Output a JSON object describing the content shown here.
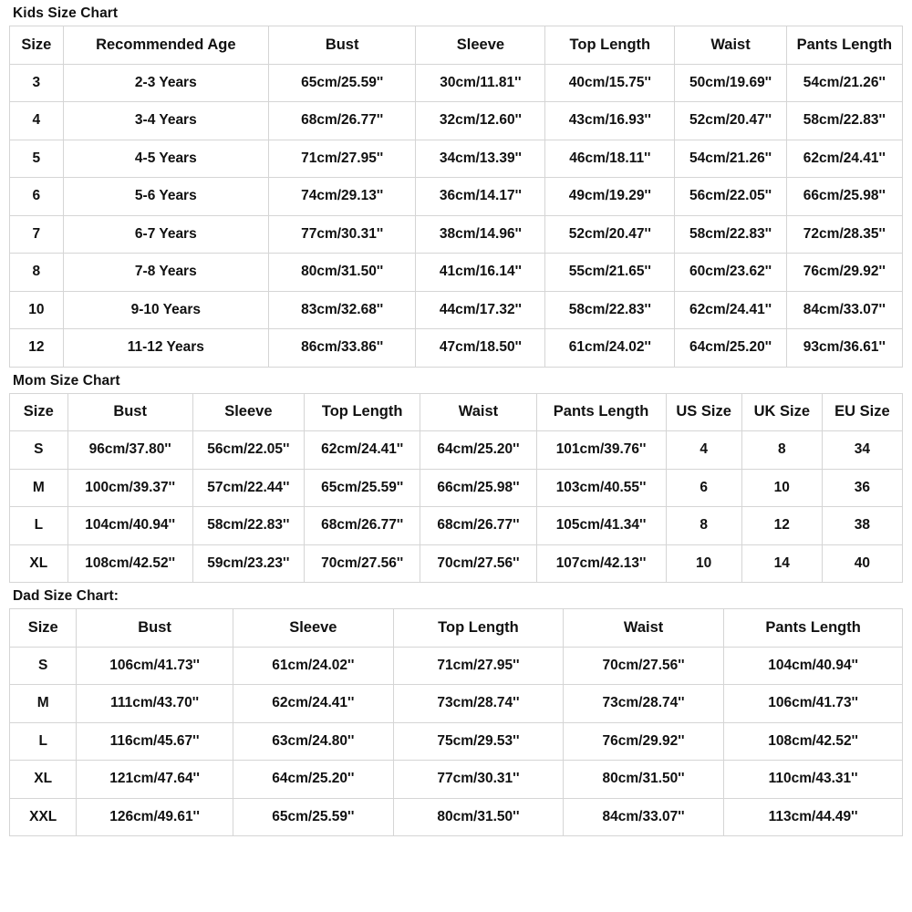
{
  "page": {
    "background": "#ffffff",
    "text_color": "#111111",
    "border_color": "#d5d5d5"
  },
  "sections": [
    {
      "id": "kids",
      "title": "Kids Size Chart",
      "columns": [
        "Size",
        "Recommended Age",
        "Bust",
        "Sleeve",
        "Top Length",
        "Waist",
        "Pants Length"
      ],
      "col_widths": [
        "6%",
        "23%",
        "16.5%",
        "14.5%",
        "14.5%",
        "12.5%",
        "13%"
      ],
      "rows": [
        [
          "3",
          "2-3 Years",
          "65cm/25.59''",
          "30cm/11.81''",
          "40cm/15.75''",
          "50cm/19.69''",
          "54cm/21.26''"
        ],
        [
          "4",
          "3-4 Years",
          "68cm/26.77''",
          "32cm/12.60''",
          "43cm/16.93''",
          "52cm/20.47''",
          "58cm/22.83''"
        ],
        [
          "5",
          "4-5 Years",
          "71cm/27.95''",
          "34cm/13.39''",
          "46cm/18.11''",
          "54cm/21.26''",
          "62cm/24.41''"
        ],
        [
          "6",
          "5-6 Years",
          "74cm/29.13''",
          "36cm/14.17''",
          "49cm/19.29''",
          "56cm/22.05''",
          "66cm/25.98''"
        ],
        [
          "7",
          "6-7 Years",
          "77cm/30.31''",
          "38cm/14.96''",
          "52cm/20.47''",
          "58cm/22.83''",
          "72cm/28.35''"
        ],
        [
          "8",
          "7-8 Years",
          "80cm/31.50''",
          "41cm/16.14''",
          "55cm/21.65''",
          "60cm/23.62''",
          "76cm/29.92''"
        ],
        [
          "10",
          "9-10 Years",
          "83cm/32.68''",
          "44cm/17.32''",
          "58cm/22.83''",
          "62cm/24.41''",
          "84cm/33.07''"
        ],
        [
          "12",
          "11-12 Years",
          "86cm/33.86''",
          "47cm/18.50''",
          "61cm/24.02''",
          "64cm/25.20''",
          "93cm/36.61''"
        ]
      ]
    },
    {
      "id": "mom",
      "title": "Mom Size Chart",
      "columns": [
        "Size",
        "Bust",
        "Sleeve",
        "Top Length",
        "Waist",
        "Pants Length",
        "US Size",
        "UK Size",
        "EU Size"
      ],
      "col_widths": [
        "6.5%",
        "14%",
        "12.5%",
        "13%",
        "13%",
        "14.5%",
        "8.5%",
        "9%",
        "9%"
      ],
      "rows": [
        [
          "S",
          "96cm/37.80''",
          "56cm/22.05''",
          "62cm/24.41''",
          "64cm/25.20''",
          "101cm/39.76''",
          "4",
          "8",
          "34"
        ],
        [
          "M",
          "100cm/39.37''",
          "57cm/22.44''",
          "65cm/25.59''",
          "66cm/25.98''",
          "103cm/40.55''",
          "6",
          "10",
          "36"
        ],
        [
          "L",
          "104cm/40.94''",
          "58cm/22.83''",
          "68cm/26.77''",
          "68cm/26.77''",
          "105cm/41.34''",
          "8",
          "12",
          "38"
        ],
        [
          "XL",
          "108cm/42.52''",
          "59cm/23.23''",
          "70cm/27.56''",
          "70cm/27.56''",
          "107cm/42.13''",
          "10",
          "14",
          "40"
        ]
      ]
    },
    {
      "id": "dad",
      "title": "Dad Size Chart:",
      "columns": [
        "Size",
        "Bust",
        "Sleeve",
        "Top Length",
        "Waist",
        "Pants Length"
      ],
      "col_widths": [
        "7.5%",
        "17.5%",
        "18%",
        "19%",
        "18%",
        "20%"
      ],
      "rows": [
        [
          "S",
          "106cm/41.73''",
          "61cm/24.02''",
          "71cm/27.95''",
          "70cm/27.56''",
          "104cm/40.94''"
        ],
        [
          "M",
          "111cm/43.70''",
          "62cm/24.41''",
          "73cm/28.74''",
          "73cm/28.74''",
          "106cm/41.73''"
        ],
        [
          "L",
          "116cm/45.67''",
          "63cm/24.80''",
          "75cm/29.53''",
          "76cm/29.92''",
          "108cm/42.52''"
        ],
        [
          "XL",
          "121cm/47.64''",
          "64cm/25.20''",
          "77cm/30.31''",
          "80cm/31.50''",
          "110cm/43.31''"
        ],
        [
          "XXL",
          "126cm/49.61''",
          "65cm/25.59''",
          "80cm/31.50''",
          "84cm/33.07''",
          "113cm/44.49''"
        ]
      ]
    }
  ]
}
